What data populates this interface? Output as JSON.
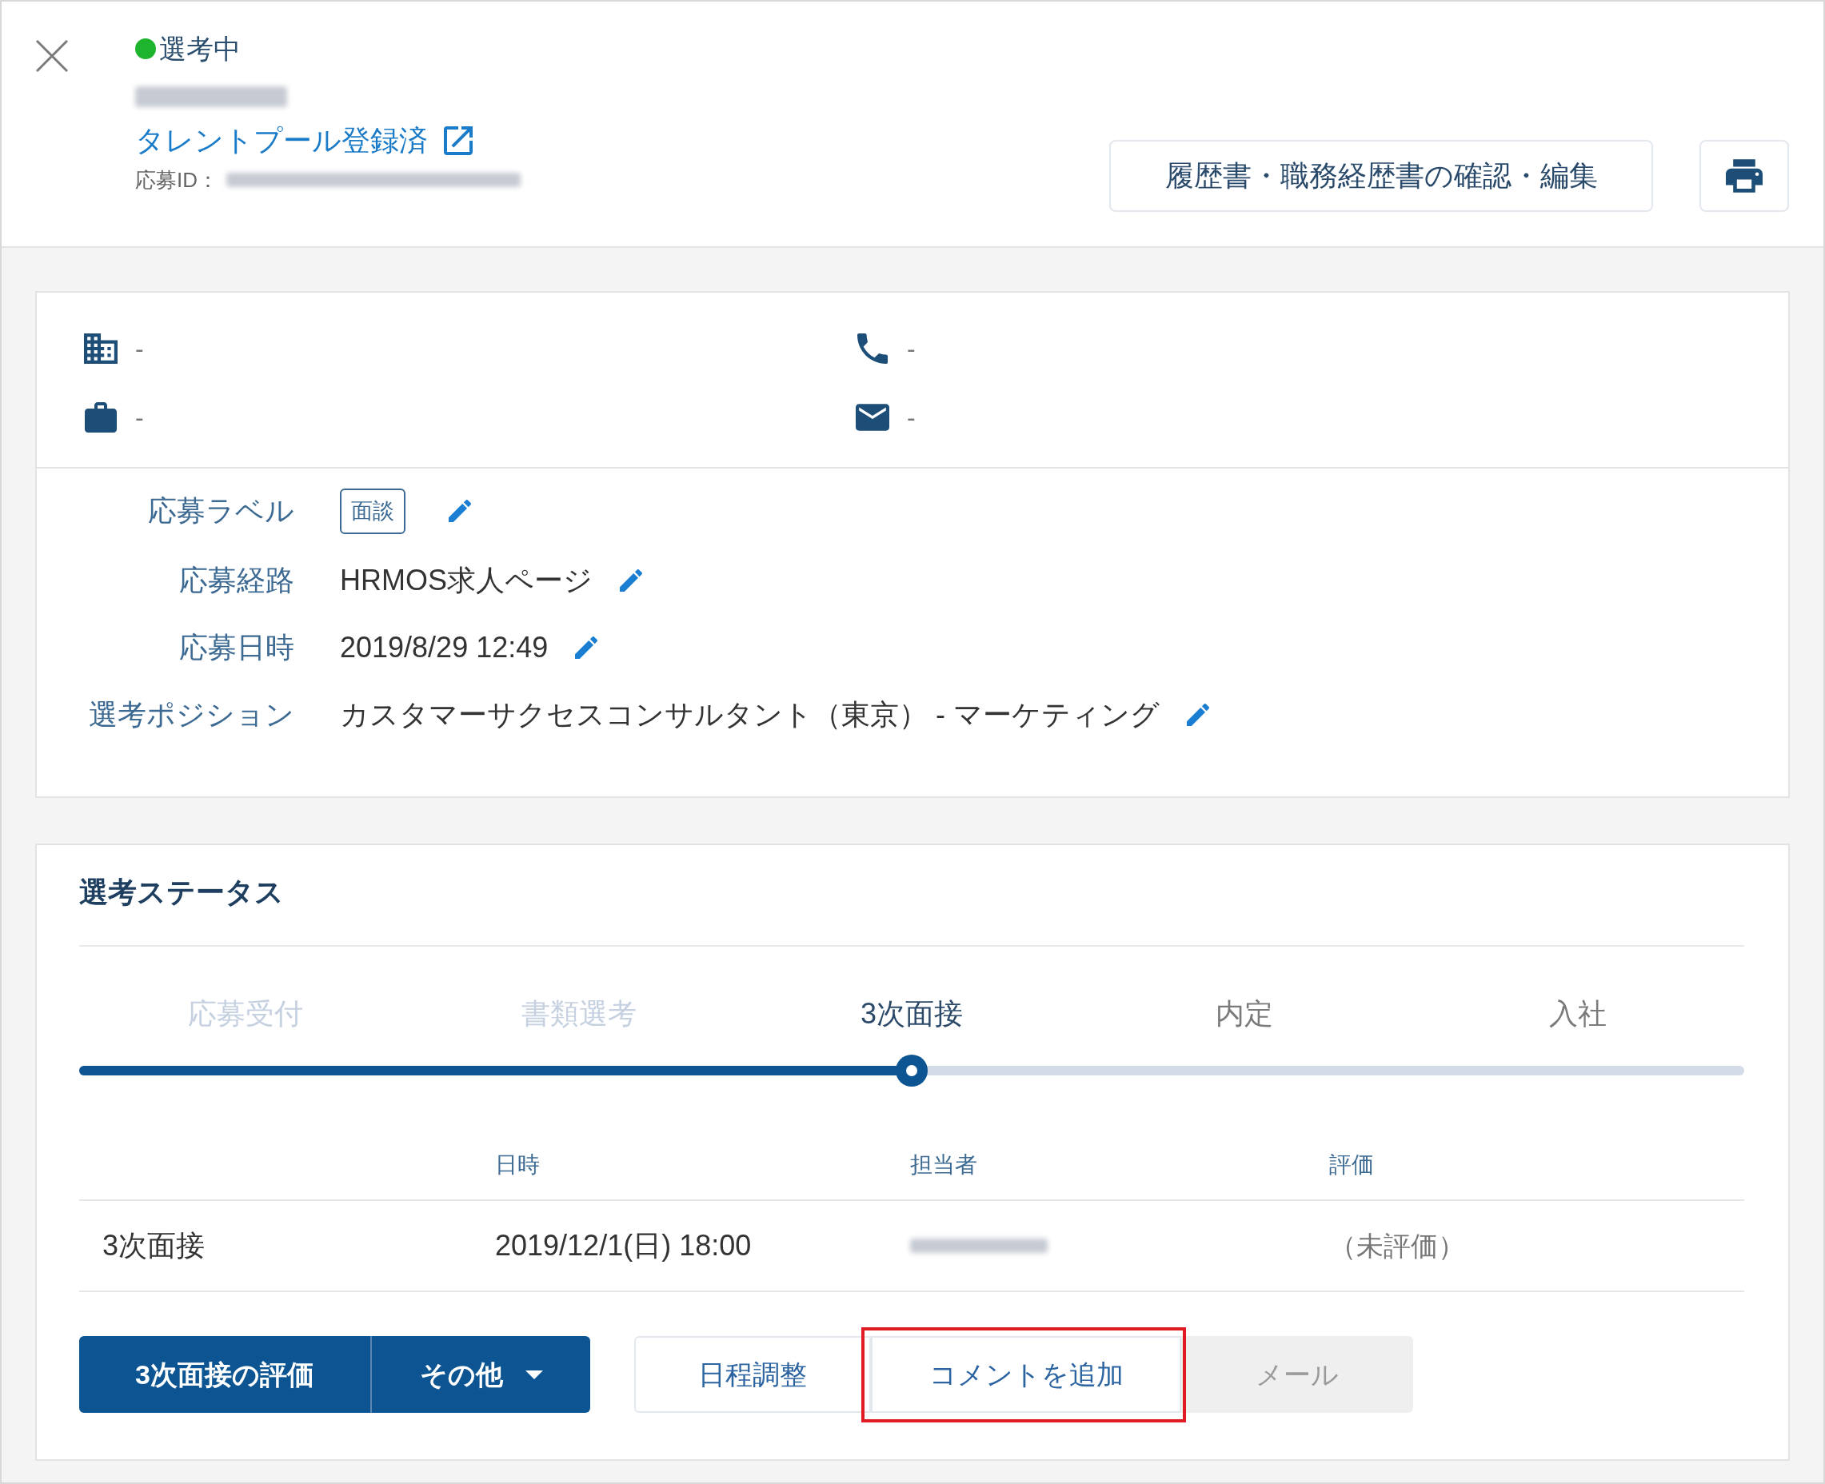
{
  "header": {
    "status": {
      "label": "選考中",
      "color": "#1eb42d"
    },
    "talent_pool_link": "タレントプール登録済",
    "application_id_label": "応募ID：",
    "resume_button": "履歴書・職務経歴書の確認・編集"
  },
  "contact": [
    {
      "kind": "company",
      "value": "-"
    },
    {
      "kind": "phone",
      "value": "-"
    },
    {
      "kind": "job",
      "value": "-"
    },
    {
      "kind": "email",
      "value": "-"
    }
  ],
  "fields": [
    {
      "label": "応募ラベル",
      "kind": "badge",
      "value": "面談"
    },
    {
      "label": "応募経路",
      "kind": "text",
      "value": "HRMOS求人ページ"
    },
    {
      "label": "応募日時",
      "kind": "text",
      "value": "2019/8/29 12:49"
    },
    {
      "label": "選考ポジション",
      "kind": "text",
      "value": "カスタマーサクセスコンサルタント（東京） - マーケティング"
    }
  ],
  "selection_status": {
    "title": "選考ステータス",
    "steps": [
      {
        "label": "応募受付",
        "completed": true,
        "selected": false
      },
      {
        "label": "書類選考",
        "completed": true,
        "selected": false
      },
      {
        "label": "3次面接",
        "completed": false,
        "selected": true
      },
      {
        "label": "内定",
        "completed": false,
        "selected": false
      },
      {
        "label": "入社",
        "completed": false,
        "selected": false
      }
    ],
    "progress": {
      "level": 0.5
    },
    "table": {
      "columns": [
        "日時",
        "担当者",
        "評価"
      ],
      "rows": [
        {
          "stage": "3次面接",
          "datetime": "2019/12/1(日) 18:00",
          "rating": "（未評価）"
        }
      ]
    },
    "primary_actions": [
      {
        "kind": "button",
        "label": "3次面接の評価"
      },
      {
        "kind": "dropdown",
        "label": "その他"
      }
    ],
    "secondary_actions": [
      {
        "label": "日程調整",
        "disabled": false,
        "highlighted": false
      },
      {
        "label": "コメントを追加",
        "disabled": false,
        "highlighted": true
      },
      {
        "label": "メール",
        "disabled": true,
        "highlighted": false
      }
    ]
  }
}
